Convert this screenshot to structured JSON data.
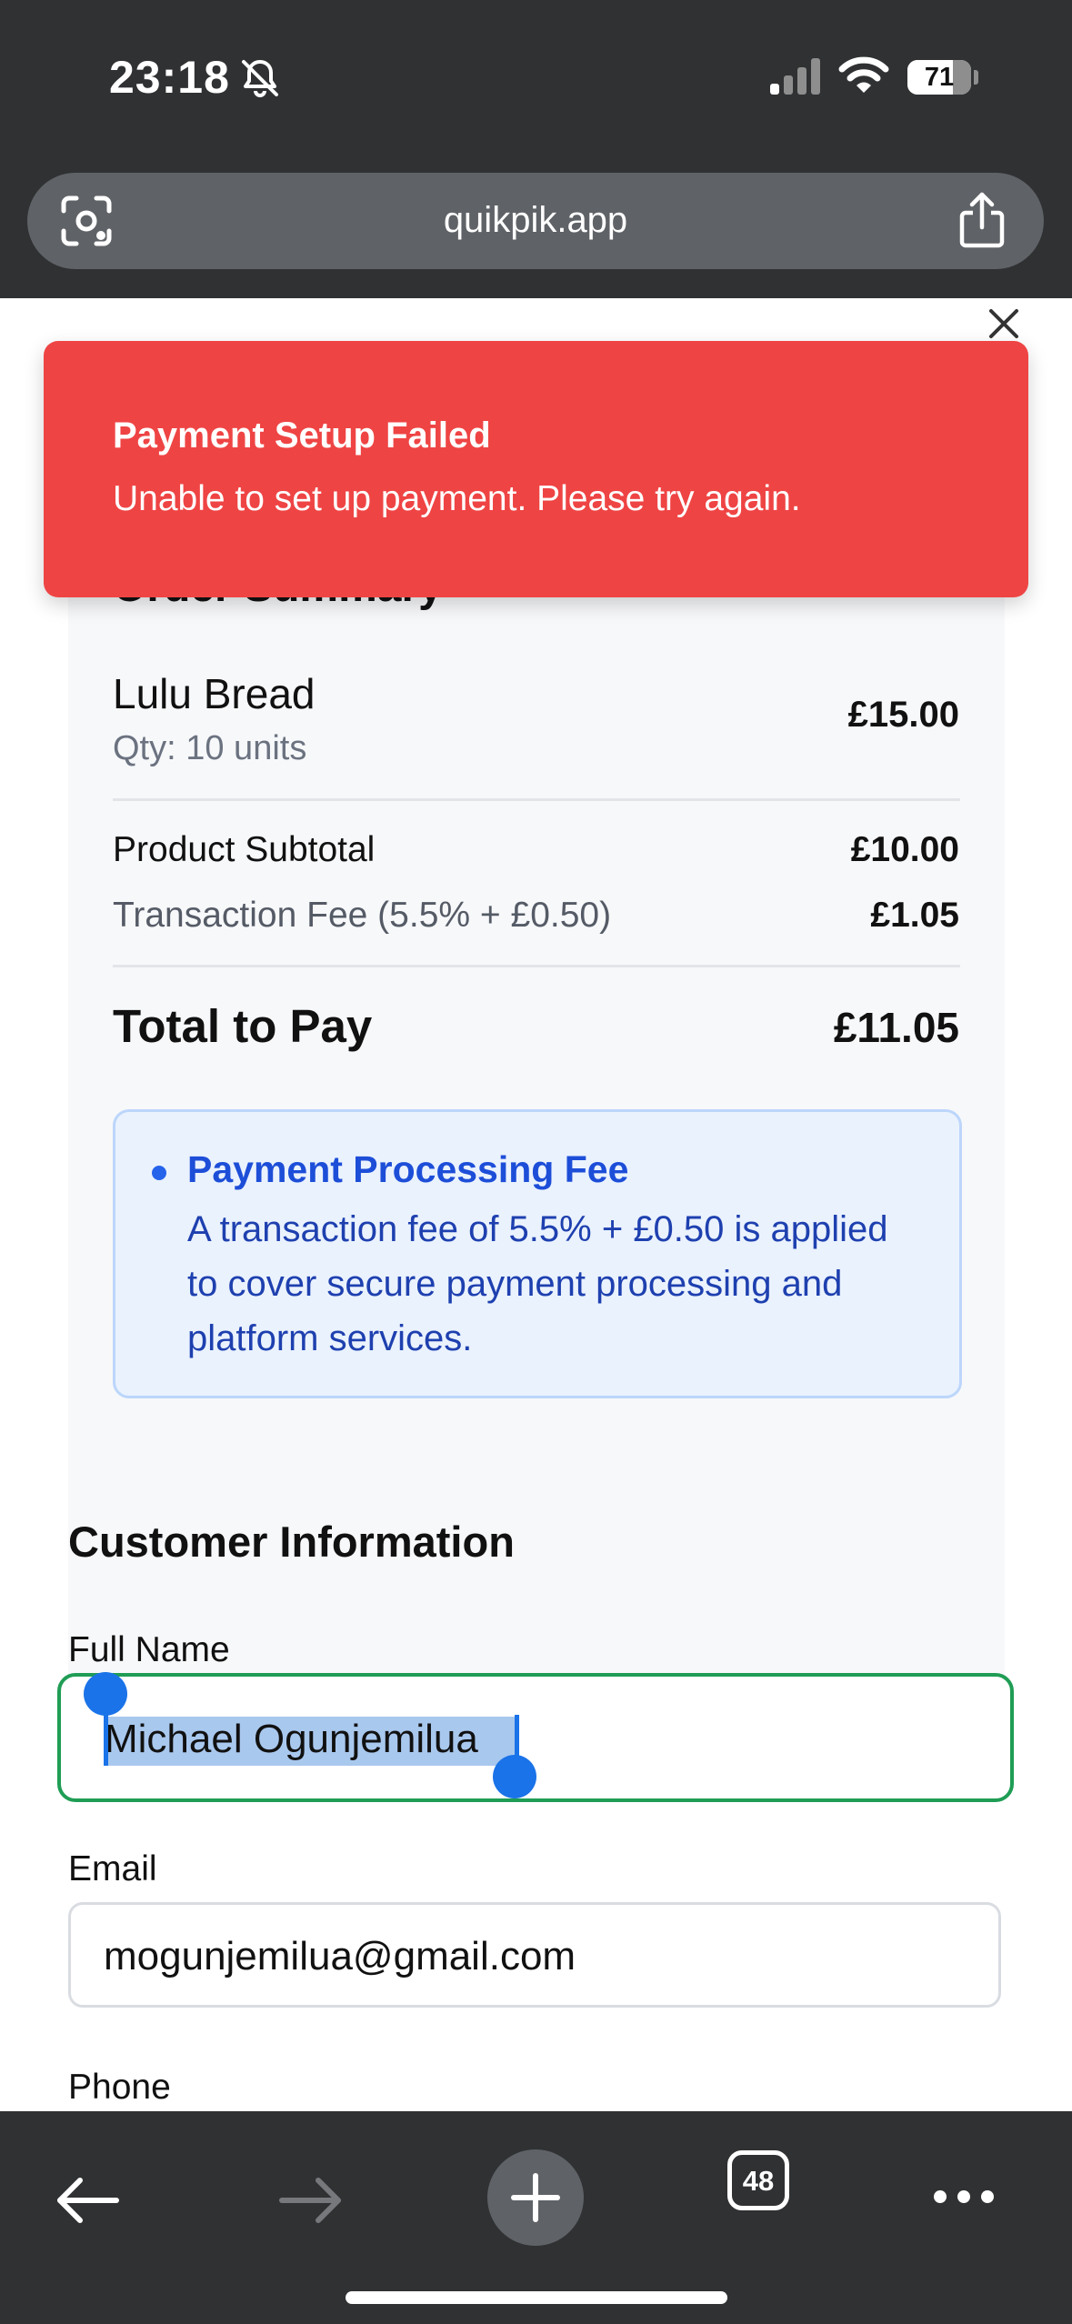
{
  "status_bar": {
    "time": "23:18",
    "battery_percent": 71,
    "battery_label": "71"
  },
  "browser": {
    "url": "quikpik.app",
    "tab_count": "48"
  },
  "toast": {
    "title": "Payment Setup Failed",
    "message": "Unable to set up payment. Please try again."
  },
  "order_summary": {
    "title": "Order Summary",
    "item_name": "Lulu Bread",
    "item_qty": "Qty: 10 units",
    "item_price": "£15.00",
    "subtotal_label": "Product Subtotal",
    "subtotal_value": "£10.00",
    "fee_label": "Transaction Fee (5.5% + £0.50)",
    "fee_value": "£1.05",
    "total_label": "Total to Pay",
    "total_value": "£11.05"
  },
  "fee_info": {
    "title": "Payment Processing Fee",
    "body": "A transaction fee of 5.5% + £0.50 is applied to cover secure payment processing and platform services."
  },
  "customer": {
    "heading": "Customer Information",
    "full_name_label": "Full Name",
    "full_name_value": "Michael Ogunjemilua",
    "email_label": "Email",
    "email_value": "mogunjemilua@gmail.com",
    "phone_label": "Phone"
  },
  "colors": {
    "toast_bg": "#ef4444",
    "focus_ring": "#1f9d55",
    "info_text": "#1d4ed8",
    "selection": "#a9c8ee"
  }
}
